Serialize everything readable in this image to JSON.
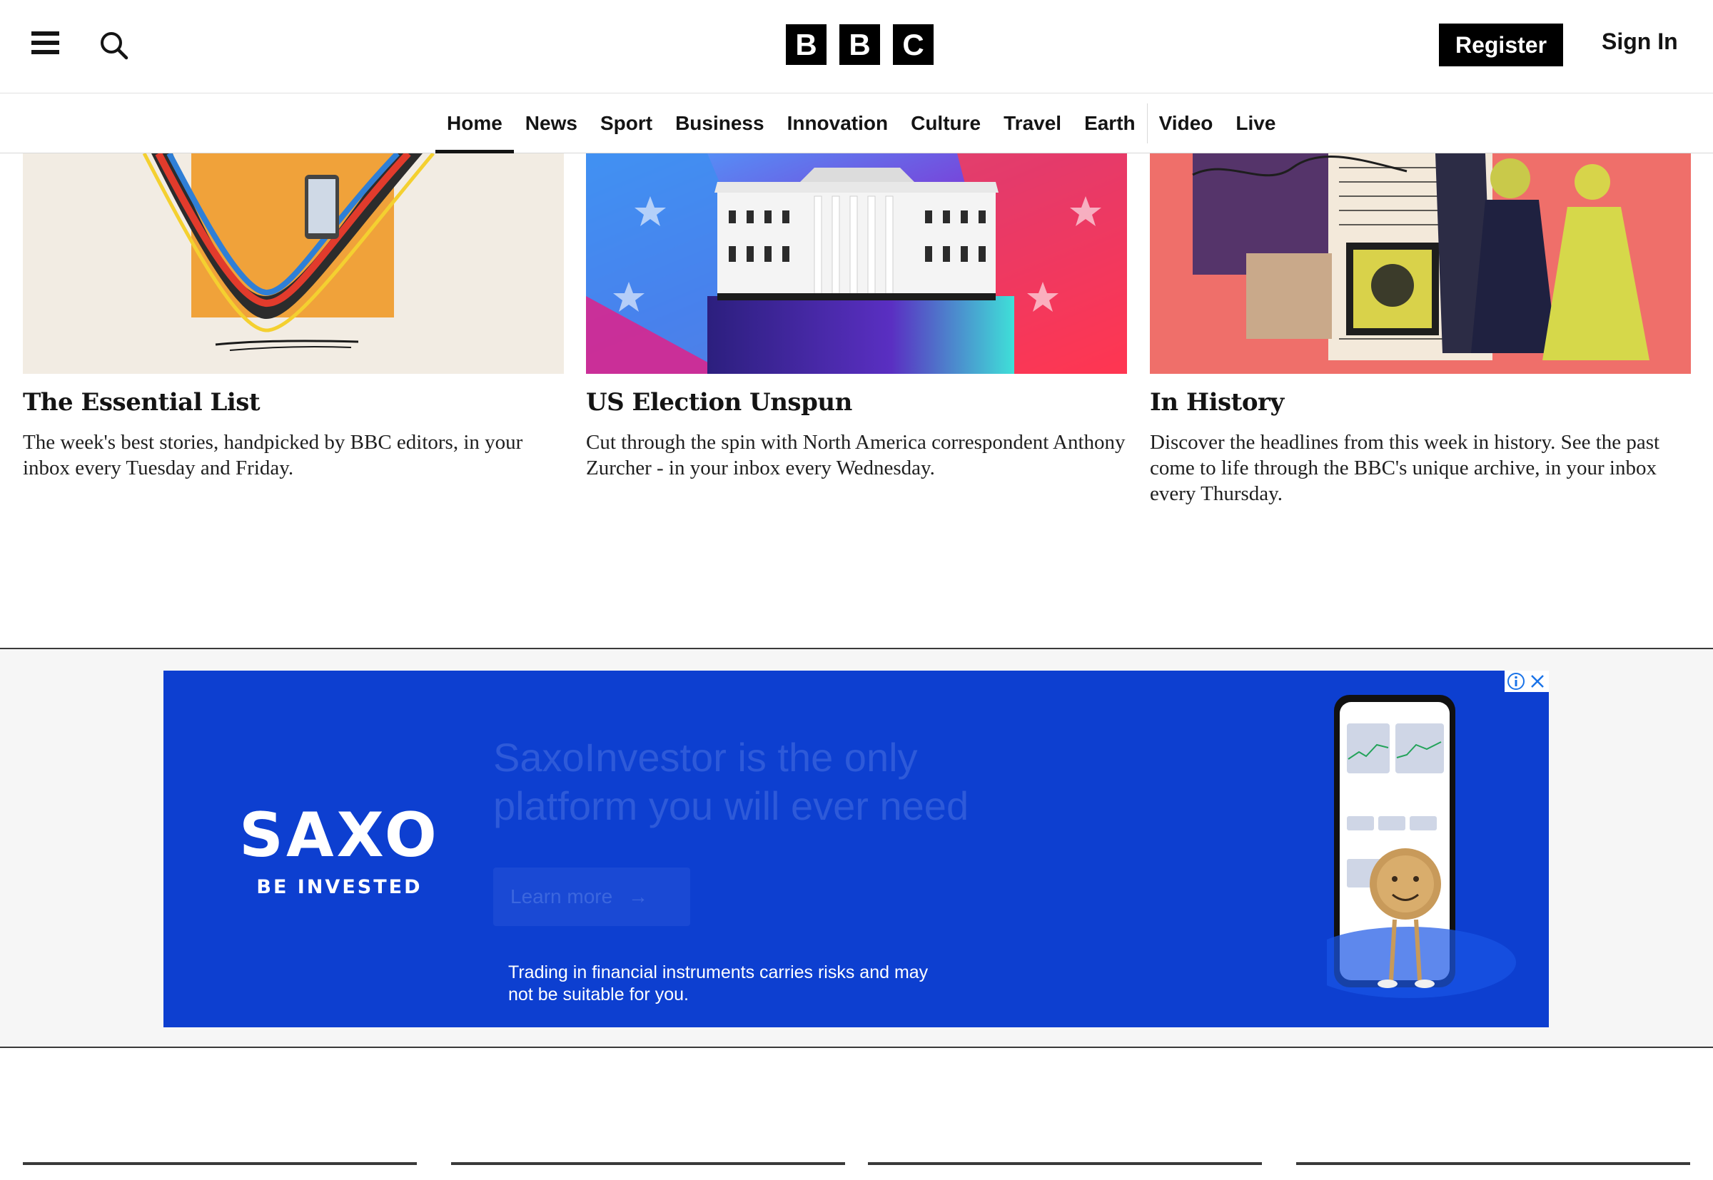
{
  "header": {
    "logo_letters": [
      "B",
      "B",
      "C"
    ],
    "register_label": "Register",
    "signin_label": "Sign In",
    "icons": {
      "menu": "hamburger-menu-icon",
      "search": "search-icon"
    }
  },
  "nav": {
    "items": [
      {
        "label": "Home",
        "active": true
      },
      {
        "label": "News"
      },
      {
        "label": "Sport"
      },
      {
        "label": "Business"
      },
      {
        "label": "Innovation"
      },
      {
        "label": "Culture"
      },
      {
        "label": "Travel"
      },
      {
        "label": "Earth"
      },
      {
        "label": "Video"
      },
      {
        "label": "Live"
      }
    ]
  },
  "newsletters": [
    {
      "title": "The Essential List",
      "description": "The week's best stories, handpicked by BBC editors, in your inbox every Tuesday and Friday."
    },
    {
      "title": "US Election Unspun",
      "description": "Cut through the spin with North America correspondent Anthony Zurcher - in your inbox every Wednesday."
    },
    {
      "title": "In History",
      "description": "Discover the headlines from this week in history. See the past come to life through the BBC's unique archive, in your inbox every Thursday."
    }
  ],
  "ad": {
    "brand": "SAXO",
    "tagline": "BE INVESTED",
    "headline": "SaxoInvestor is the only platform you will ever need",
    "cta_label": "Learn more",
    "disclaimer": "Trading in financial instruments carries risks and may not be suitable for you.",
    "background_color": "#0d3fd0",
    "icons": {
      "info": "ad-info-icon",
      "close": "ad-close-icon"
    }
  }
}
